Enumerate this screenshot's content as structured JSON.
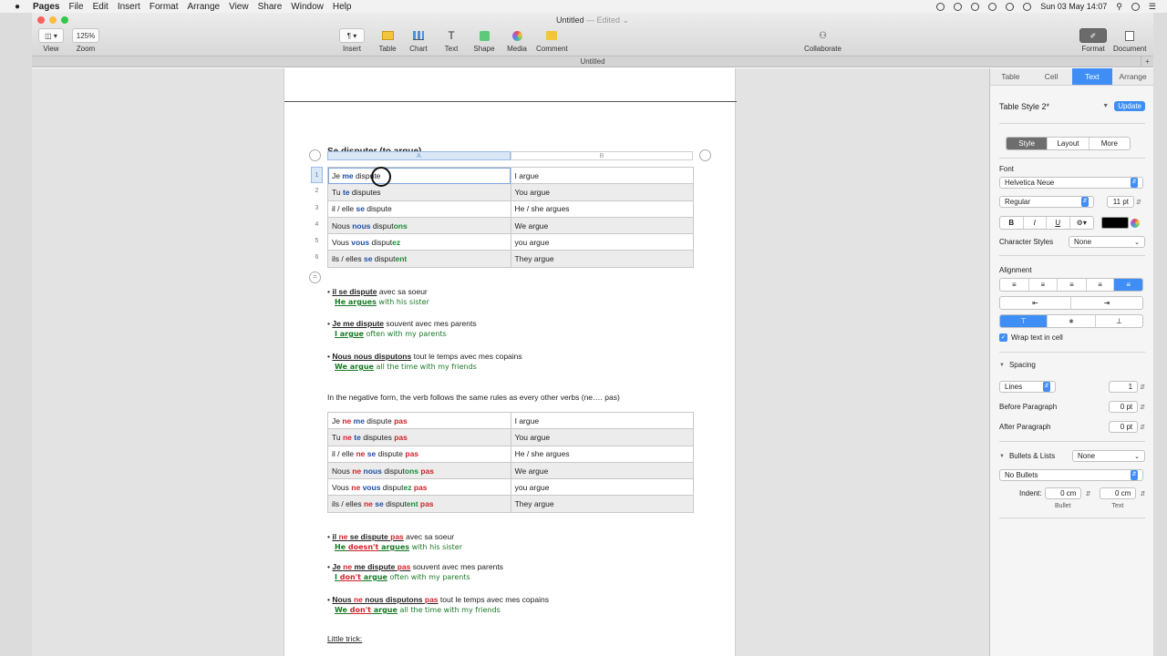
{
  "menubar": {
    "app": "Pages",
    "items": [
      "File",
      "Edit",
      "Insert",
      "Format",
      "Arrange",
      "View",
      "Share",
      "Window",
      "Help"
    ],
    "clock": "Sun 03 May  14:07"
  },
  "window": {
    "title": "Untitled",
    "edited": "— Edited ⌄",
    "tab_title": "Untitled"
  },
  "toolbar": {
    "view": "View",
    "zoom": "Zoom",
    "zoom_value": "125%",
    "insert": "Insert",
    "table": "Table",
    "chart": "Chart",
    "text": "Text",
    "shape": "Shape",
    "media": "Media",
    "comment": "Comment",
    "collaborate": "Collaborate",
    "format": "Format",
    "document": "Document"
  },
  "doc": {
    "heading": "Se disputer (to argue)",
    "col_a": "A",
    "col_b": "B",
    "row_numbers": [
      "1",
      "2",
      "3",
      "4",
      "5",
      "6"
    ],
    "table1": [
      {
        "pre": "Je ",
        "pron": "me",
        "stem": " dispute",
        "end": "",
        "en": "I argue"
      },
      {
        "pre": "Tu ",
        "pron": "te",
        "stem": " disputes",
        "end": "",
        "en": "You argue"
      },
      {
        "pre": "il / elle ",
        "pron": "se",
        "stem": " dispute",
        "end": "",
        "en": "He / she argues"
      },
      {
        "pre": "Nous ",
        "pron": "nous",
        "stem": " disput",
        "end": "ons",
        "en": "We argue"
      },
      {
        "pre": "Vous ",
        "pron": "vous",
        "stem": " disput",
        "end": "ez",
        "en": "you argue"
      },
      {
        "pre": "ils / elles ",
        "pron": "se",
        "stem": " disput",
        "end": "ent",
        "en": "They argue"
      }
    ],
    "examples": [
      {
        "fr_bold": "il se dispute",
        "fr_rest": " avec sa soeur",
        "en_bold": "He argues",
        "en_rest": " with his sister"
      },
      {
        "fr_bold": "Je me dispute",
        "fr_rest": " souvent avec mes parents",
        "en_bold": "I argue",
        "en_rest": " often with my parents"
      },
      {
        "fr_bold": "Nous nous disputons",
        "fr_rest": " tout le temps avec mes copains",
        "en_bold": "We argue",
        "en_rest": " all the time with my friends"
      }
    ],
    "negative_intro": "In the negative form, the verb follows the same rules as every other verbs (ne…. pas)",
    "table2": [
      {
        "a": "Je ",
        "ne": "ne",
        "b": " ",
        "pron": "me",
        "c": " dispute ",
        "end": "",
        "pas": "pas",
        "en": "I argue"
      },
      {
        "a": "Tu ",
        "ne": "ne",
        "b": " ",
        "pron": "te",
        "c": " disputes ",
        "end": "",
        "pas": "pas",
        "en": "You argue"
      },
      {
        "a": "il / elle ",
        "ne": "ne",
        "b": " ",
        "pron": "se",
        "c": " dispute ",
        "end": "",
        "pas": "pas",
        "en": "He / she argues"
      },
      {
        "a": "Nous ",
        "ne": "ne",
        "b": " ",
        "pron": "nous",
        "c": " disput",
        "end": "ons",
        "pas": " pas",
        "en": "We argue"
      },
      {
        "a": "Vous ",
        "ne": "ne",
        "b": " ",
        "pron": "vous",
        "c": " disput",
        "end": "ez",
        "pas": " pas",
        "en": "you argue"
      },
      {
        "a": "ils / elles ",
        "ne": "ne",
        "b": " ",
        "pron": "se",
        "c": " disput",
        "end": "ent",
        "pas": "  pas",
        "en": "They argue"
      }
    ],
    "neg_examples": [
      {
        "f1": "il ",
        "n1": "ne",
        "f2": " se dispute ",
        "n2": "pas",
        "rest": " avec sa soeur",
        "e1": "He ",
        "en_neg": "doesn't",
        "e2": " argues",
        "en_rest": " with his sister"
      },
      {
        "f1": "Je ",
        "n1": "ne",
        "f2": " me dispute ",
        "n2": "pas",
        "rest": " souvent avec mes parents",
        "e1": "I ",
        "en_neg": "don't",
        "e2": " argue",
        "en_rest": " often with my parents"
      },
      {
        "f1": "Nous ",
        "n1": "ne",
        "f2": " nous disputons ",
        "n2": "pas",
        "rest": " tout le temps avec mes copains",
        "e1": "We ",
        "en_neg": "don't",
        "e2": " argue",
        "en_rest": " all the time with my friends"
      }
    ],
    "little_trick": "Little trick:"
  },
  "inspector": {
    "tabs": [
      "Table",
      "Cell",
      "Text",
      "Arrange"
    ],
    "active_tab": "Text",
    "table_style": "Table Style 2*",
    "update": "Update",
    "sub_tabs": [
      "Style",
      "Layout",
      "More"
    ],
    "font_label": "Font",
    "font": "Helvetica Neue",
    "typeface": "Regular",
    "size": "11 pt",
    "bold": "B",
    "italic": "I",
    "underline": "U",
    "char_styles_label": "Character Styles",
    "char_styles": "None",
    "alignment_label": "Alignment",
    "wrap_label": "Wrap text in cell",
    "spacing_label": "Spacing",
    "lines": "Lines",
    "lines_value": "1",
    "before_label": "Before Paragraph",
    "before_value": "0 pt",
    "after_label": "After Paragraph",
    "after_value": "0 pt",
    "bullets_label": "Bullets & Lists",
    "bullets_value": "None",
    "no_bullets": "No Bullets",
    "indent_label": "Indent:",
    "indent_bullet": "0 cm",
    "indent_text": "0 cm",
    "bullet_caption": "Bullet",
    "text_caption": "Text"
  },
  "colors": {
    "accent": "#3f8ef5",
    "pronoun": "#1f4fa3",
    "ending": "#1a8a36",
    "negation": "#d0222a"
  }
}
